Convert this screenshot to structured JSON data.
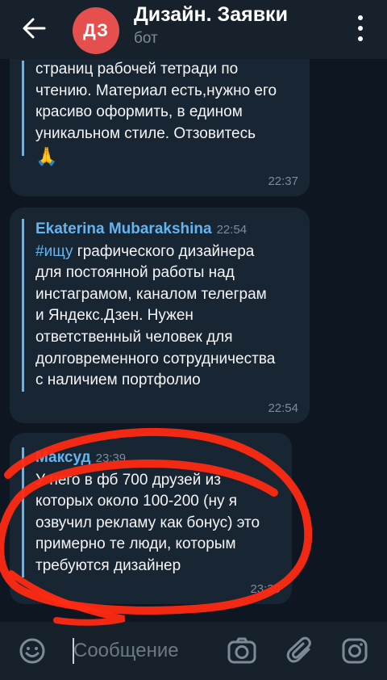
{
  "header": {
    "avatar_initials": "ДЗ",
    "title": "Дизайн. Заявки",
    "subtitle": "бот",
    "back_icon": "arrow-left-icon",
    "menu_icon": "more-vertical-icon"
  },
  "messages": [
    {
      "lines": [
        "страниц рабочей тетради по",
        "чтению. Материал есть,нужно его",
        "красиво оформить, в едином",
        "уникальном стиле.  Отзовитесь"
      ],
      "emoji": "🙏",
      "time": "22:37"
    },
    {
      "sender": "Ekaterina Mubarakshina",
      "sender_time": "22:54",
      "hashtag": "#ищу",
      "first_line_rest": " графического дизайнера",
      "lines": [
        "для постоянной работы над",
        "инстаграмом, каналом телеграм",
        "и Яндекс.Дзен. Нужен",
        "ответственный человек для",
        "долговременного сотрудничества",
        "с наличием портфолио"
      ],
      "time": "22:54"
    },
    {
      "sender": "Максуд",
      "sender_time": "23:39",
      "lines": [
        "У него в фб 700 друзей из",
        "которых около 100-200 (ну я",
        "озвучил рекламу как бонус) это",
        "примерно те люди, которым",
        "требуются дизайнер"
      ],
      "time": "23:39"
    }
  ],
  "composer": {
    "placeholder": "Сообщение",
    "emoji_icon": "smile-icon",
    "camera_icon": "camera-icon",
    "attach_icon": "paperclip-icon",
    "instagram_icon": "instagram-icon"
  },
  "colors": {
    "background": "#0e1621",
    "header": "#17212b",
    "bubble": "#182533",
    "accent": "#64b5ef",
    "avatar": "#e5504f",
    "annotation": "#ff2a12"
  }
}
